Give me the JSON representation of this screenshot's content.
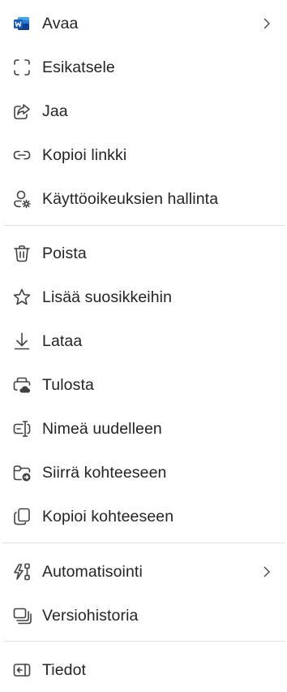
{
  "menu": {
    "items": [
      {
        "label": "Avaa",
        "icon": "word-icon",
        "submenu": true
      },
      {
        "label": "Esikatsele",
        "icon": "preview-frame-icon"
      },
      {
        "label": "Jaa",
        "icon": "share-icon"
      },
      {
        "label": "Kopioi linkki",
        "icon": "link-icon"
      },
      {
        "label": "Käyttöoikeuksien hallinta",
        "icon": "person-settings-icon"
      },
      {
        "label": "Poista",
        "icon": "trash-icon"
      },
      {
        "label": "Lisää suosikkeihin",
        "icon": "star-icon"
      },
      {
        "label": "Lataa",
        "icon": "download-icon"
      },
      {
        "label": "Tulosta",
        "icon": "print-icon"
      },
      {
        "label": "Nimeä uudelleen",
        "icon": "rename-icon"
      },
      {
        "label": "Siirrä kohteeseen",
        "icon": "folder-move-icon"
      },
      {
        "label": "Kopioi kohteeseen",
        "icon": "copy-icon"
      },
      {
        "label": "Automatisointi",
        "icon": "automation-flash-icon",
        "submenu": true
      },
      {
        "label": "Versiohistoria",
        "icon": "version-history-icon"
      },
      {
        "label": "Tiedot",
        "icon": "info-panel-icon"
      }
    ]
  },
  "colors": {
    "word_blue": "#185ABD",
    "icon_gray": "#424242",
    "text": "#242424",
    "divider": "#E1E1E1"
  }
}
